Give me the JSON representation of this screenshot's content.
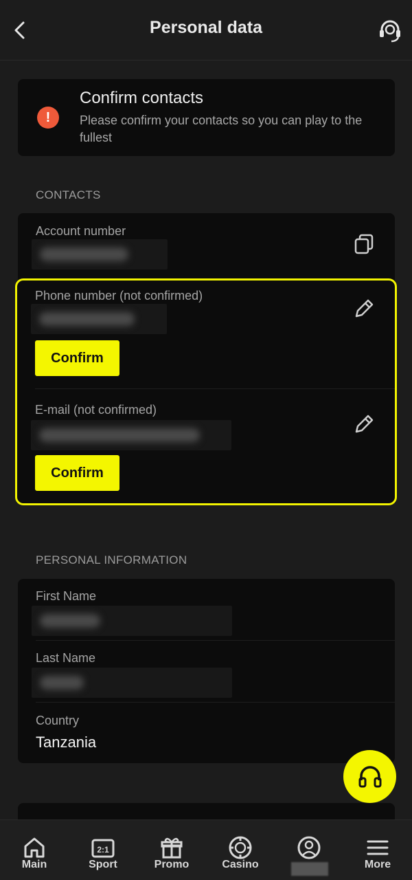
{
  "header": {
    "title": "Personal data"
  },
  "alert": {
    "title": "Confirm contacts",
    "text": "Please confirm your contacts so you can play to the fullest",
    "icon": "!",
    "icon_color": "#ef5a3a"
  },
  "contacts": {
    "section_label": "CONTACTS",
    "account_label": "Account number",
    "phone_label": "Phone number (not confirmed)",
    "email_label": "E-mail (not confirmed)",
    "confirm_label": "Confirm"
  },
  "personal": {
    "section_label": "PERSONAL INFORMATION",
    "first_name_label": "First Name",
    "last_name_label": "Last Name",
    "country_label": "Country",
    "country_value": "Tanzania"
  },
  "nav": {
    "items": [
      {
        "label": "Main",
        "icon": "home-icon"
      },
      {
        "label": "Sport",
        "icon": "scoreboard-icon"
      },
      {
        "label": "Promo",
        "icon": "gift-icon"
      },
      {
        "label": "Casino",
        "icon": "casino-chip-icon"
      },
      {
        "label": "",
        "icon": "profile-icon"
      },
      {
        "label": "More",
        "icon": "menu-icon"
      }
    ]
  },
  "colors": {
    "accent": "#f4f600",
    "background": "#1c1c1c",
    "card": "#0c0c0c"
  }
}
